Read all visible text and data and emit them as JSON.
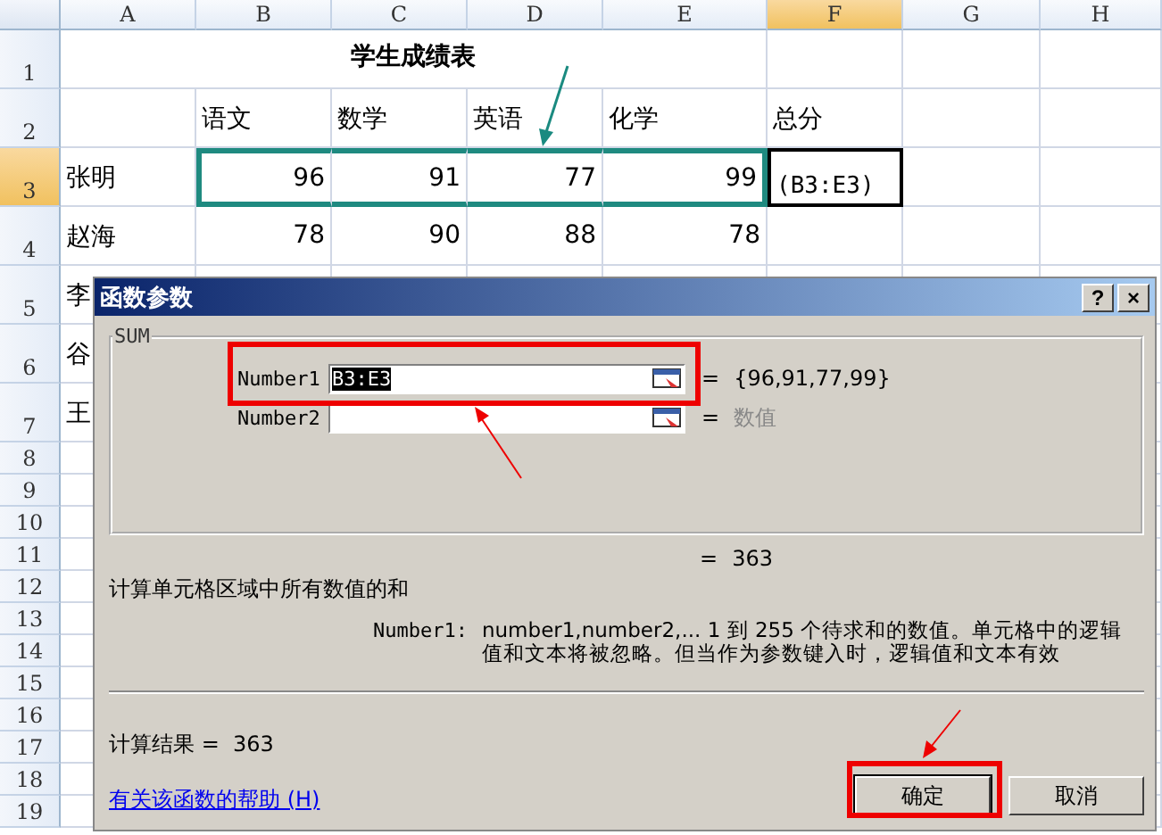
{
  "sheet": {
    "columns": [
      {
        "label": "A",
        "selected": false
      },
      {
        "label": "B",
        "selected": false
      },
      {
        "label": "C",
        "selected": false
      },
      {
        "label": "D",
        "selected": false
      },
      {
        "label": "E",
        "selected": false
      },
      {
        "label": "F",
        "selected": true
      },
      {
        "label": "G",
        "selected": false
      },
      {
        "label": "H",
        "selected": false
      }
    ],
    "rows": [
      {
        "label": "1",
        "selected": false,
        "cells": [
          {
            "text": "学生成绩表",
            "kind": "title",
            "referenced": false,
            "active": false
          },
          null,
          null,
          null,
          null,
          null,
          null,
          null
        ]
      },
      {
        "label": "2",
        "selected": false,
        "cells": [
          null,
          {
            "text": "语文",
            "kind": "text",
            "referenced": false,
            "active": false
          },
          {
            "text": "数学",
            "kind": "text",
            "referenced": false,
            "active": false
          },
          {
            "text": "英语",
            "kind": "text",
            "referenced": false,
            "active": false
          },
          {
            "text": "化学",
            "kind": "text",
            "referenced": false,
            "active": false
          },
          {
            "text": "总分",
            "kind": "text",
            "referenced": false,
            "active": false
          },
          null,
          null
        ]
      },
      {
        "label": "3",
        "selected": true,
        "cells": [
          {
            "text": "张明",
            "kind": "text",
            "referenced": false,
            "active": false
          },
          {
            "text": "96",
            "kind": "number",
            "referenced": true,
            "active": false
          },
          {
            "text": "91",
            "kind": "number",
            "referenced": true,
            "active": false
          },
          {
            "text": "77",
            "kind": "number",
            "referenced": true,
            "active": false
          },
          {
            "text": "99",
            "kind": "number",
            "referenced": true,
            "active": false
          },
          {
            "text": "(B3:E3)",
            "kind": "formula",
            "referenced": false,
            "active": true
          },
          null,
          null
        ]
      },
      {
        "label": "4",
        "selected": false,
        "cells": [
          {
            "text": "赵海",
            "kind": "text",
            "referenced": false,
            "active": false
          },
          {
            "text": "78",
            "kind": "number",
            "referenced": false,
            "active": false
          },
          {
            "text": "90",
            "kind": "number",
            "referenced": false,
            "active": false
          },
          {
            "text": "88",
            "kind": "number",
            "referenced": false,
            "active": false
          },
          {
            "text": "78",
            "kind": "number",
            "referenced": false,
            "active": false
          },
          null,
          null,
          null
        ]
      },
      {
        "label": "5",
        "selected": false,
        "cells": [
          {
            "text": "李",
            "kind": "text",
            "referenced": false,
            "active": false
          },
          null,
          null,
          null,
          null,
          null,
          null,
          null
        ]
      },
      {
        "label": "6",
        "selected": false,
        "cells": [
          {
            "text": "谷",
            "kind": "text",
            "referenced": false,
            "active": false
          },
          null,
          null,
          null,
          null,
          null,
          null,
          null
        ]
      },
      {
        "label": "7",
        "selected": false,
        "cells": [
          {
            "text": "王",
            "kind": "text",
            "referenced": false,
            "active": false
          },
          null,
          null,
          null,
          null,
          null,
          null,
          null
        ]
      },
      {
        "label": "8",
        "selected": false
      },
      {
        "label": "9",
        "selected": false
      },
      {
        "label": "10",
        "selected": false
      },
      {
        "label": "11",
        "selected": false
      },
      {
        "label": "12",
        "selected": false
      },
      {
        "label": "13",
        "selected": false
      },
      {
        "label": "14",
        "selected": false
      },
      {
        "label": "15",
        "selected": false
      },
      {
        "label": "16",
        "selected": false
      },
      {
        "label": "17",
        "selected": false
      },
      {
        "label": "18",
        "selected": false
      },
      {
        "label": "19",
        "selected": false
      }
    ]
  },
  "dialog": {
    "title": "函数参数",
    "help_button": "?",
    "close_button": "×",
    "group": "SUM",
    "arguments": [
      {
        "label": "Number1",
        "value": "B3:E3",
        "value_selected": true,
        "equals": "=",
        "result": "{96,91,77,99}",
        "result_muted": false
      },
      {
        "label": "Number2",
        "equals": "=",
        "result": "数值",
        "result_muted": true
      }
    ],
    "formula_equals": "=",
    "formula_result": "363",
    "description": "计算单元格区域中所有数值的和",
    "argument_help_label": "Number1:",
    "argument_help": "number1,number2,...  1 到 255 个待求和的数值。单元格中的逻辑值和文本将被忽略。但当作为参数键入时，逻辑值和文本有效",
    "result_label": "计算结果 =",
    "result": "363",
    "help_link": "有关该函数的帮助 (H)",
    "buttons": [
      {
        "label": "确定",
        "default": true
      },
      {
        "label": "取消",
        "default": false
      }
    ]
  }
}
